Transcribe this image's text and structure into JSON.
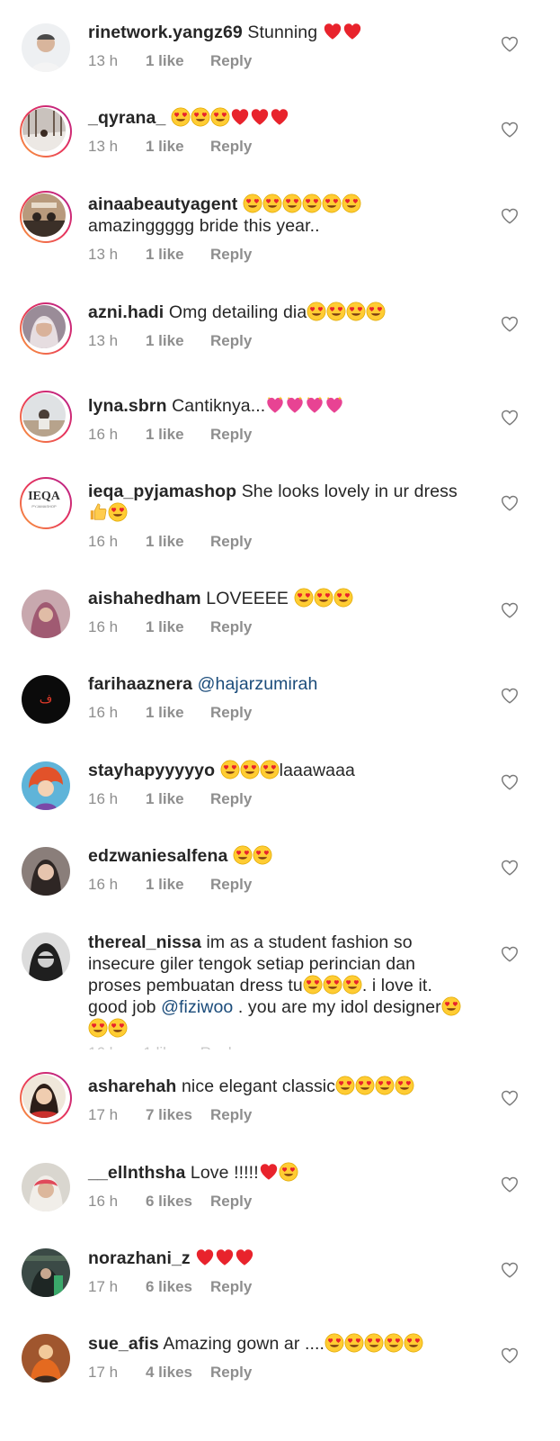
{
  "colors": {
    "ring_start": "#f9a23b",
    "ring_end": "#b21f8f",
    "meta": "#8e8e8e",
    "mention": "#1a4b7a",
    "heart": "#e8232c",
    "face": "#ffcc33"
  },
  "comments": [
    {
      "username": "rinetwork.yangz69",
      "text": "Stunning",
      "emoji": "red-heart x2",
      "time": "13 h",
      "likes": "1 like",
      "reply": "Reply"
    },
    {
      "username": "_qyrana_",
      "text": "",
      "emoji": "heart-eyes x3, red-heart x3",
      "time": "13 h",
      "likes": "1 like",
      "reply": "Reply"
    },
    {
      "username": "ainaabeautyagent",
      "text": "amazinggggg bride this year..",
      "emoji": "heart-eyes x6",
      "time": "13 h",
      "likes": "1 like",
      "reply": "Reply"
    },
    {
      "username": "azni.hadi",
      "text": "Omg detailing dia",
      "emoji": "heart-eyes x4",
      "time": "13 h",
      "likes": "1 like",
      "reply": "Reply"
    },
    {
      "username": "lyna.sbrn",
      "text": "Cantiknya...",
      "emoji": "sparkling-heart x4",
      "time": "16 h",
      "likes": "1 like",
      "reply": "Reply"
    },
    {
      "username": "ieqa_pyjamashop",
      "text": "She looks lovely in ur dress",
      "emoji": "thumbs-up, heart-eyes",
      "avatar_text": "IEQA",
      "avatar_subtext": "PYJAMASHOP",
      "time": "16 h",
      "likes": "1 like",
      "reply": "Reply"
    },
    {
      "username": "aishahedham",
      "text": "LOVEEEE",
      "emoji": "heart-eyes x3",
      "time": "16 h",
      "likes": "1 like",
      "reply": "Reply"
    },
    {
      "username": "farihaaznera",
      "text": "@hajarzumirah",
      "avatar_text": "ف",
      "time": "16 h",
      "likes": "1 like",
      "reply": "Reply"
    },
    {
      "username": "stayhapyyyyyo",
      "text": "laaawaaa",
      "emoji": "heart-eyes x3",
      "time": "16 h",
      "likes": "1 like",
      "reply": "Reply"
    },
    {
      "username": "edzwaniesalfena",
      "text": "",
      "emoji": "heart-eyes x2",
      "time": "16 h",
      "likes": "1 like",
      "reply": "Reply"
    },
    {
      "username": "thereal_nissa",
      "text_1": "im as a student fashion so",
      "text_2": "insecure giler tengok setiap perincian dan",
      "text_3": "proses pembuatan dress tu",
      "text_4": ". i love it.",
      "text_5": "good job ",
      "mention": "@fiziwoo",
      "text_6": " . you are my idol designer",
      "emoji": "heart-eyes x6"
    },
    {
      "username": "asharehah",
      "text": "nice elegant classic",
      "emoji": "heart-eyes x4",
      "time": "17 h",
      "likes": "7 likes",
      "reply": "Reply"
    },
    {
      "username": "__ellnthsha",
      "text": "Love !!!!!",
      "emoji": "red-heart, heart-eyes",
      "time": "16 h",
      "likes": "6 likes",
      "reply": "Reply"
    },
    {
      "username": "norazhani_z",
      "text": "",
      "emoji": "red-heart x3",
      "time": "17 h",
      "likes": "6 likes",
      "reply": "Reply"
    },
    {
      "username": "sue_afis",
      "text": "Amazing gown ar ....",
      "emoji": "heart-eyes x5",
      "time": "17 h",
      "likes": "4 likes",
      "reply": "Reply"
    }
  ]
}
